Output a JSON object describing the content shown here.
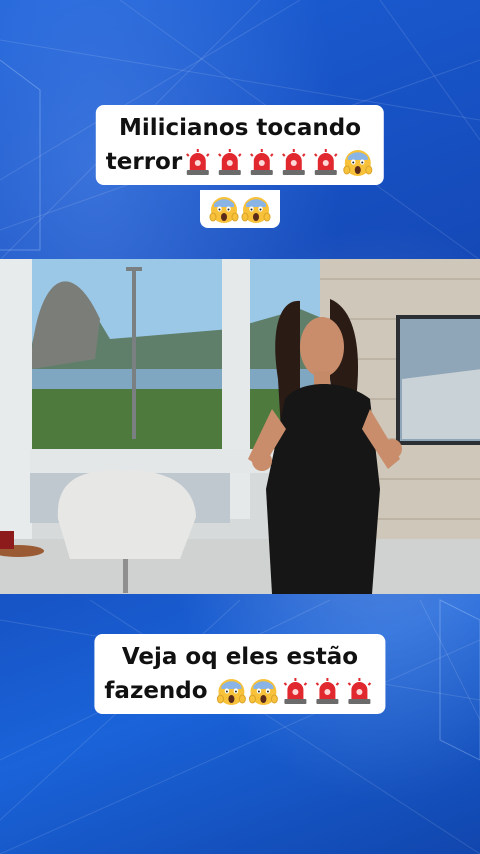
{
  "caption_top": {
    "line1": "Milicianos tocando",
    "line2": "terror",
    "line2_icons": [
      "siren-icon",
      "siren-icon",
      "siren-icon",
      "siren-icon",
      "siren-icon",
      "scream-face-icon"
    ],
    "line3_icons": [
      "scream-face-icon",
      "scream-face-icon"
    ]
  },
  "caption_bottom": {
    "line1": "Veja oq eles estão",
    "line2": "fazendo",
    "line2_icons": [
      "scream-face-icon",
      "scream-face-icon",
      "siren-icon",
      "siren-icon",
      "siren-icon"
    ]
  },
  "colors": {
    "background_blue": "#1a56c8",
    "caption_bg": "#ffffff",
    "caption_text": "#111111",
    "siren_red": "#e0282e",
    "scream_yellow": "#f7c23a"
  }
}
